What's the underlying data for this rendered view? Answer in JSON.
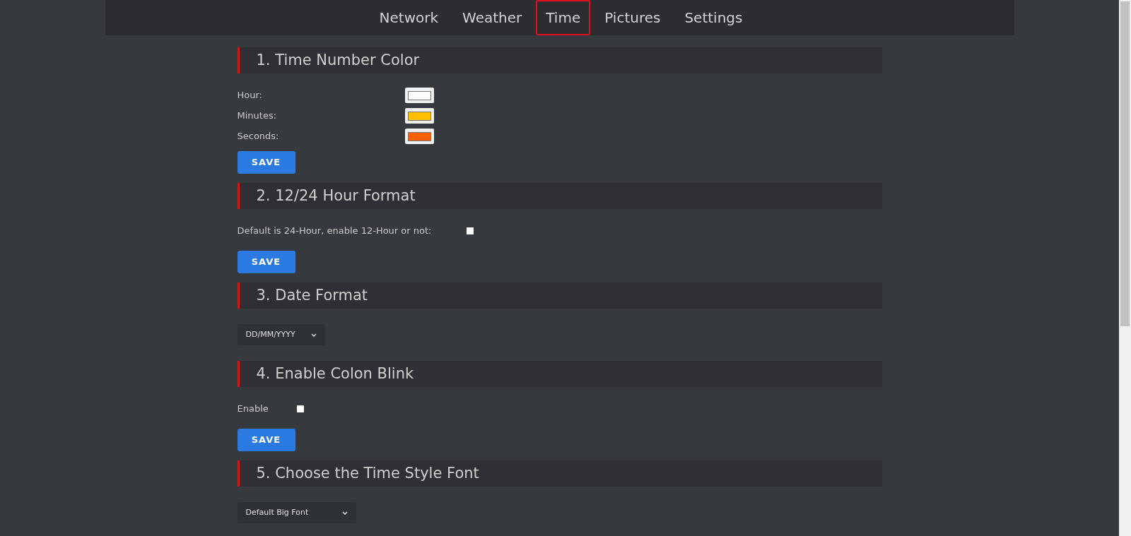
{
  "nav": [
    {
      "label": "Network",
      "selected": false
    },
    {
      "label": "Weather",
      "selected": false
    },
    {
      "label": "Time",
      "selected": true
    },
    {
      "label": "Pictures",
      "selected": false
    },
    {
      "label": "Settings",
      "selected": false
    }
  ],
  "sections": [
    {
      "title": "1. Time Number Color",
      "kind": "colors",
      "rows": [
        {
          "label": "Hour:",
          "color": "#ffffff"
        },
        {
          "label": "Minutes:",
          "color": "#ffc000"
        },
        {
          "label": "Seconds:",
          "color": "#ff6000"
        }
      ],
      "button": "SAVE"
    },
    {
      "title": "2. 12/24 Hour Format",
      "kind": "checkbox",
      "label": "Default is 24-Hour, enable 12-Hour or not:",
      "checked": false,
      "button": "SAVE"
    },
    {
      "title": "3. Date Format",
      "kind": "select",
      "value": "DD/MM/YYYY"
    },
    {
      "title": "4. Enable Colon Blink",
      "kind": "checkbox",
      "label": "Enable",
      "checked": false,
      "button": "SAVE"
    },
    {
      "title": "5. Choose the Time Style Font",
      "kind": "select",
      "value": "Default Big Font"
    }
  ]
}
